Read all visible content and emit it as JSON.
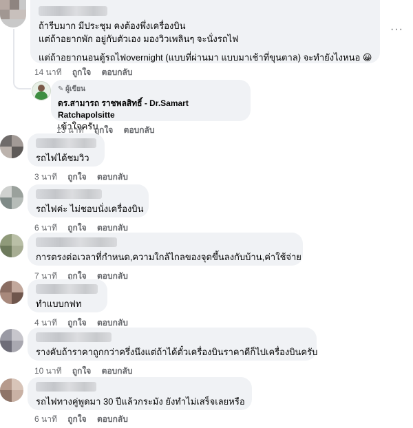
{
  "first_comment": {
    "lines": [
      "ถ้ารีบมาก มีประชุม คงต้องพึ่งเครื่องบิน",
      "แต่ถ้าอยากพัก อยู่กับตัวเอง มองวิวเพลินๆ จะนั่งรถไฟ",
      "",
      "แต่ถ้าอยากนอนตู้รถไฟovernight (แบบที่ผ่านมา แบบมาเช้าที่ขุนตาล) จะทำยังไงหนอ 😀"
    ],
    "time": "14 นาที",
    "like": "ถูกใจ",
    "reply": "ตอบกลับ"
  },
  "author_reply": {
    "badge": "ผู้เขียน",
    "name": "ดร.สามารถ ราชพลสิทธิ์ - Dr.Samart Ratchapolsitte",
    "text": "เข้าใจครับ",
    "time": "13 นาที",
    "like": "ถูกใจ",
    "reply": "ตอบกลับ"
  },
  "comments": [
    {
      "text": "รถไฟได้ชมวิว",
      "time": "3 นาที",
      "like": "ถูกใจ",
      "reply": "ตอบกลับ"
    },
    {
      "text": "รถไฟค่ะ ไม่ชอบนั่งเครื่องบิน",
      "time": "6 นาที",
      "like": "ถูกใจ",
      "reply": "ตอบกลับ"
    },
    {
      "text": "การตรงต่อเวลาที่กำหนด,ความใกล้ไกลของจุดขึ้นลงกับบ้าน,ค่าใช้จ่าย",
      "time": "7 นาที",
      "like": "ถูกใจ",
      "reply": "ตอบกลับ"
    },
    {
      "text": "ทำแบบกฟท",
      "time": "4 นาที",
      "like": "ถูกใจ",
      "reply": "ตอบกลับ"
    },
    {
      "text": "รางคับถ้าราคาถูกกว่าครึ่งนึงแต่ถ้าได้ตั๋วเครื่องบินราคาดีก็ไปเครื่องบินครับ",
      "time": "10 นาที",
      "like": "ถูกใจ",
      "reply": "ตอบกลับ"
    },
    {
      "text": "รถไฟทางคู่พูดมา 30 ปีแล้วกระมัง ยังทำไม่เสร็จเลยหรือ",
      "time": "6 นาที",
      "like": "ถูกใจ",
      "reply": "ตอบกลับ"
    }
  ]
}
